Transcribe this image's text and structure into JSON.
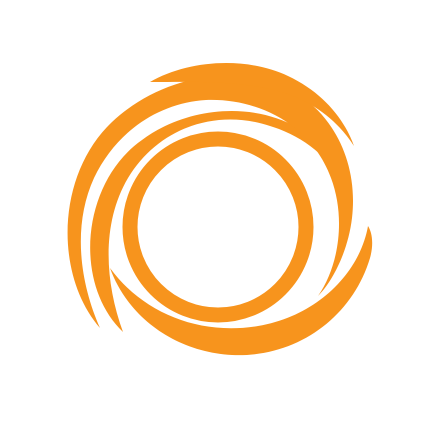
{
  "logo": {
    "icon": "orange-swirl-ring-logo",
    "color": "#F7941D",
    "background": "#FFFFFF"
  }
}
